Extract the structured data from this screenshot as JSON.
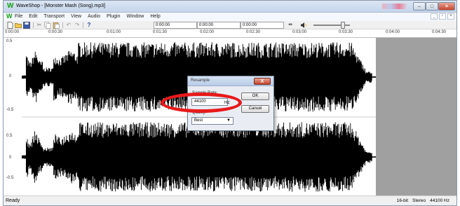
{
  "window": {
    "title": "WaveShop - [Monster Mash (Song).mp3]",
    "app_icon": "waveshop-logo-icon"
  },
  "menu": [
    "File",
    "Edit",
    "Transport",
    "View",
    "Audio",
    "Plugin",
    "Window",
    "Help"
  ],
  "toolbar": {
    "icons": [
      "new-file-icon",
      "open-folder-icon",
      "save-icon",
      "cut-icon",
      "copy-icon",
      "paste-icon",
      "undo-icon",
      "redo-icon",
      "help-icon"
    ],
    "time_fields": [
      "0:00:00",
      "0:00:00",
      "0:00:00"
    ],
    "volume_icon": "speaker-icon",
    "volume_level": 0.8
  },
  "ruler": {
    "labels": [
      "0:00:00",
      "0:00:30",
      "0:01:00",
      "0:01:30",
      "0:02:00",
      "0:02:30",
      "0:03:00",
      "0:03:30",
      "0:04:00",
      "0:04:30"
    ]
  },
  "scale": {
    "channel1": [
      "0.5",
      "0",
      "-0.5"
    ],
    "channel2": [
      "0.5",
      "0",
      "-0.5"
    ]
  },
  "dialog": {
    "title": "Resample",
    "close_label": "X",
    "sample_rate_label": "Sample Rate:",
    "sample_rate_value": "44100",
    "sample_rate_unit": "Hz",
    "ok_label": "OK",
    "cancel_label": "Cancel",
    "quality_label": "Quality:",
    "quality_value": "Best"
  },
  "status": {
    "left": "Ready",
    "bit_depth": "16-bit",
    "channels": "Stereo",
    "sample_rate": "44100 Hz"
  },
  "colors": {
    "highlight": "#e8191b",
    "waveform": "#000000",
    "end_area": "#a0a0a0"
  }
}
